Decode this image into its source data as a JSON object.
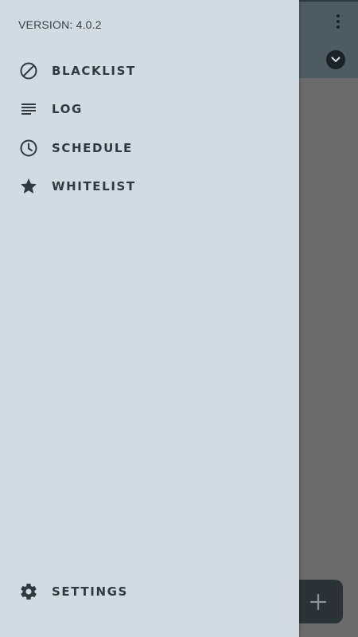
{
  "drawer": {
    "version_text": "VERSION: 4.0.2",
    "items": [
      {
        "label": "BLACKLIST",
        "icon": "block-icon"
      },
      {
        "label": "LOG",
        "icon": "list-lines-icon"
      },
      {
        "label": "SCHEDULE",
        "icon": "clock-icon"
      },
      {
        "label": "WHITELIST",
        "icon": "star-icon"
      }
    ],
    "footer": {
      "label": "SETTINGS",
      "icon": "gear-icon"
    }
  },
  "background_app": {
    "toolbar_icons": [
      "more-vertical-icon",
      "chevron-down-icon"
    ],
    "fab_icon": "plus-icon"
  },
  "colors": {
    "drawer_bg": "#d2dbe1",
    "text": "#2f3b40",
    "scrim": "#6b6b6b",
    "toolbar": "#4e5c62",
    "fab": "#2c3336"
  }
}
